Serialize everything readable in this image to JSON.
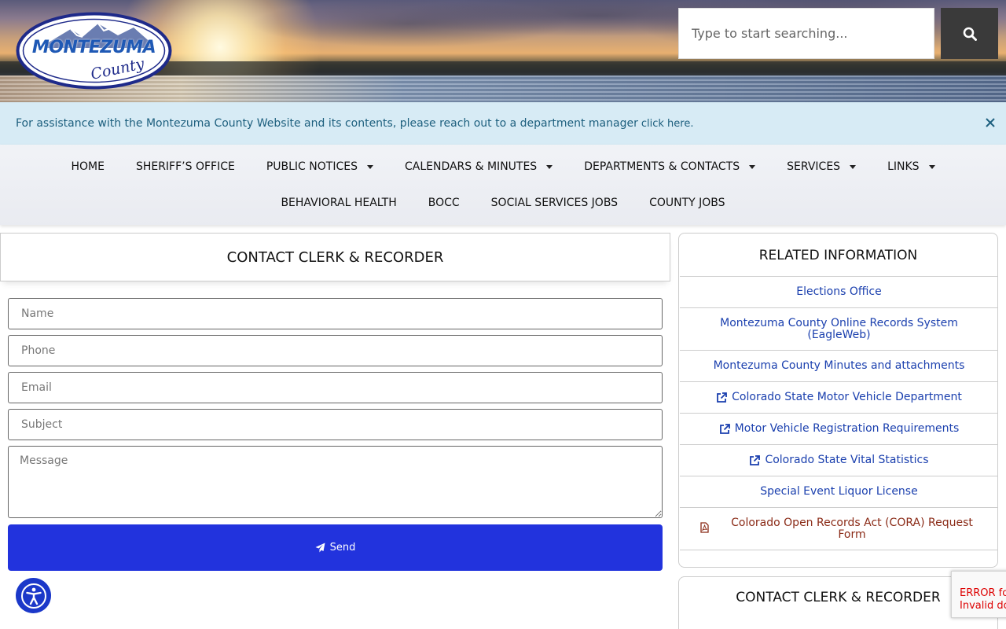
{
  "header": {
    "logo_main": "MONTEZUMA",
    "logo_sub": "County",
    "search_placeholder": "Type to start searching..."
  },
  "notice": {
    "text": "For assistance with the Montezuma County Website and its contents, please reach out to a department manager",
    "link": "click here."
  },
  "nav": {
    "row1": [
      {
        "label": "HOME",
        "dropdown": false
      },
      {
        "label": "SHERIFF’S OFFICE",
        "dropdown": false
      },
      {
        "label": "PUBLIC NOTICES",
        "dropdown": true
      },
      {
        "label": "CALENDARS & MINUTES",
        "dropdown": true
      },
      {
        "label": "DEPARTMENTS & CONTACTS",
        "dropdown": true
      },
      {
        "label": "SERVICES",
        "dropdown": true
      },
      {
        "label": "LINKS",
        "dropdown": true
      }
    ],
    "row2": [
      {
        "label": "BEHAVIORAL HEALTH"
      },
      {
        "label": "BOCC"
      },
      {
        "label": "SOCIAL SERVICES JOBS"
      },
      {
        "label": "COUNTY JOBS"
      }
    ]
  },
  "form": {
    "title": "CONTACT CLERK & RECORDER",
    "name_placeholder": "Name",
    "phone_placeholder": "Phone",
    "email_placeholder": "Email",
    "subject_placeholder": "Subject",
    "message_placeholder": "Message",
    "send_label": "Send"
  },
  "related": {
    "title": "RELATED INFORMATION",
    "items": [
      {
        "label": "Elections Office",
        "external": false
      },
      {
        "label": "Montezuma County Online Records System (EagleWeb)",
        "external": false
      },
      {
        "label": "Montezuma County Minutes and attachments",
        "external": false
      },
      {
        "label": "Colorado State Motor Vehicle Department",
        "external": true
      },
      {
        "label": "Motor Vehicle Registration Requirements",
        "external": true
      },
      {
        "label": "Colorado State Vital Statistics",
        "external": true
      },
      {
        "label": "Special Event Liquor License",
        "external": false
      },
      {
        "label": "Colorado Open Records Act (CORA) Request Form",
        "external": false
      }
    ]
  },
  "contact_box": {
    "title": "CONTACT CLERK & RECORDER"
  },
  "recaptcha": {
    "line1": "ERROR for",
    "line2": "Invalid do"
  },
  "colors": {
    "accent_blue": "#2233dd",
    "link_blue": "#1a3fae",
    "pdf_red": "#8a2a16",
    "notice_bg": "#d7ebf5"
  }
}
